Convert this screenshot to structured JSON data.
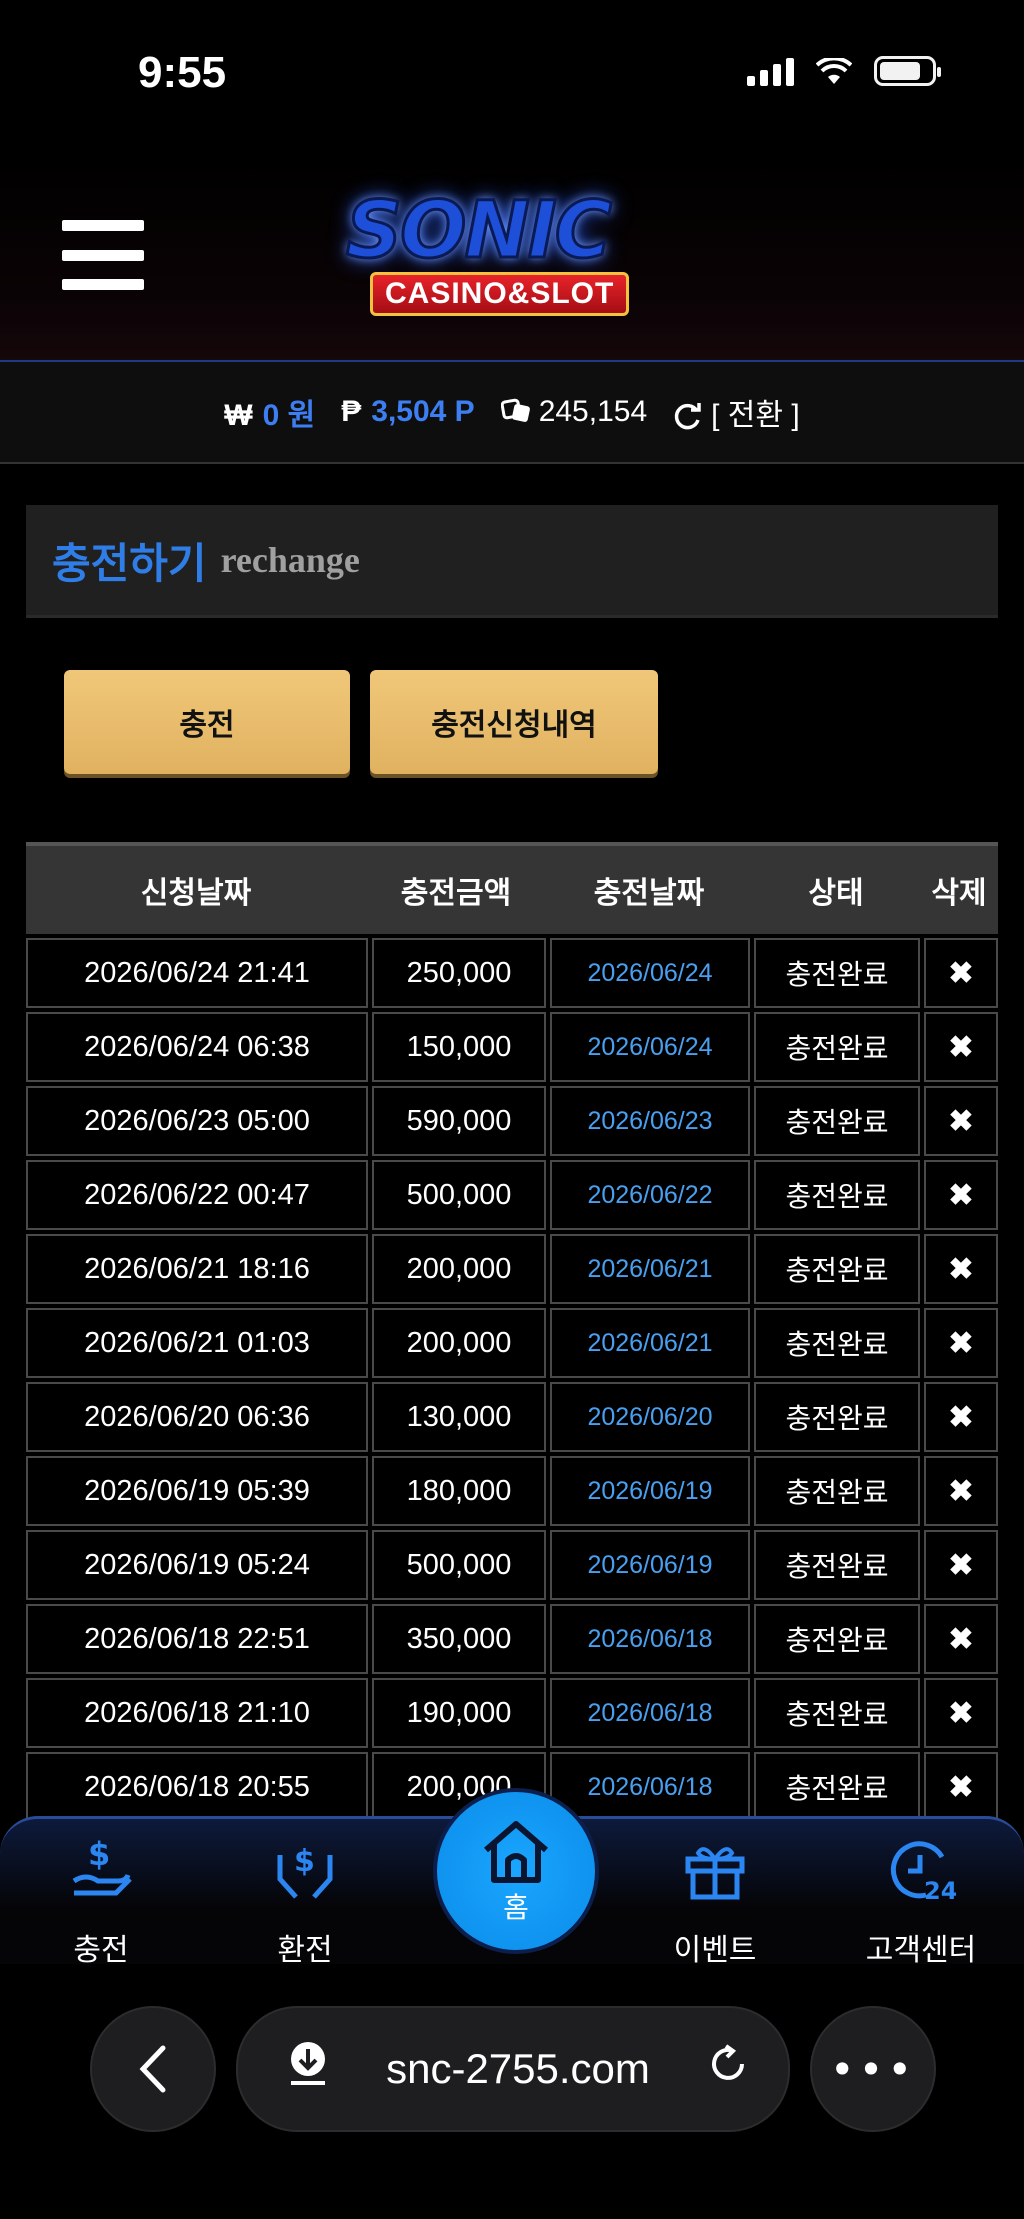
{
  "status_bar": {
    "time": "9:55"
  },
  "header": {
    "logo_main": "SONIC",
    "logo_sub": "CASINO&SLOT"
  },
  "balance": {
    "won_symbol": "₩",
    "won_value": "0 원",
    "point_symbol": "₱",
    "point_value": "3,504 P",
    "chip_value": "245,154",
    "switch_label": "[ 전환 ]"
  },
  "section": {
    "title_ko": "충전하기",
    "title_en": "rechange"
  },
  "buttons": {
    "charge": "충전",
    "history": "충전신청내역"
  },
  "table": {
    "headers": [
      "신청날짜",
      "충전금액",
      "충전날짜",
      "상태",
      "삭제"
    ],
    "rows": [
      {
        "requested": "2026/06/24 21:41",
        "amount": "250,000",
        "charged": "2026/06/24",
        "status": "충전완료"
      },
      {
        "requested": "2026/06/24 06:38",
        "amount": "150,000",
        "charged": "2026/06/24",
        "status": "충전완료"
      },
      {
        "requested": "2026/06/23 05:00",
        "amount": "590,000",
        "charged": "2026/06/23",
        "status": "충전완료"
      },
      {
        "requested": "2026/06/22 00:47",
        "amount": "500,000",
        "charged": "2026/06/22",
        "status": "충전완료"
      },
      {
        "requested": "2026/06/21 18:16",
        "amount": "200,000",
        "charged": "2026/06/21",
        "status": "충전완료"
      },
      {
        "requested": "2026/06/21 01:03",
        "amount": "200,000",
        "charged": "2026/06/21",
        "status": "충전완료"
      },
      {
        "requested": "2026/06/20 06:36",
        "amount": "130,000",
        "charged": "2026/06/20",
        "status": "충전완료"
      },
      {
        "requested": "2026/06/19 05:39",
        "amount": "180,000",
        "charged": "2026/06/19",
        "status": "충전완료"
      },
      {
        "requested": "2026/06/19 05:24",
        "amount": "500,000",
        "charged": "2026/06/19",
        "status": "충전완료"
      },
      {
        "requested": "2026/06/18 22:51",
        "amount": "350,000",
        "charged": "2026/06/18",
        "status": "충전완료"
      },
      {
        "requested": "2026/06/18 21:10",
        "amount": "190,000",
        "charged": "2026/06/18",
        "status": "충전완료"
      },
      {
        "requested": "2026/06/18 20:55",
        "amount": "200,000",
        "charged": "2026/06/18",
        "status": "충전완료"
      }
    ]
  },
  "bottom_nav": {
    "items": [
      {
        "label": "충전",
        "icon": "deposit-hand-icon"
      },
      {
        "label": "환전",
        "icon": "exchange-hands-icon"
      },
      {
        "label": "홈",
        "icon": "home-icon"
      },
      {
        "label": "이벤트",
        "icon": "gift-icon"
      },
      {
        "label": "고객센터",
        "icon": "support-24-icon"
      }
    ],
    "accent": "#2b86f2"
  },
  "browser": {
    "url": "snc-2755.com"
  }
}
